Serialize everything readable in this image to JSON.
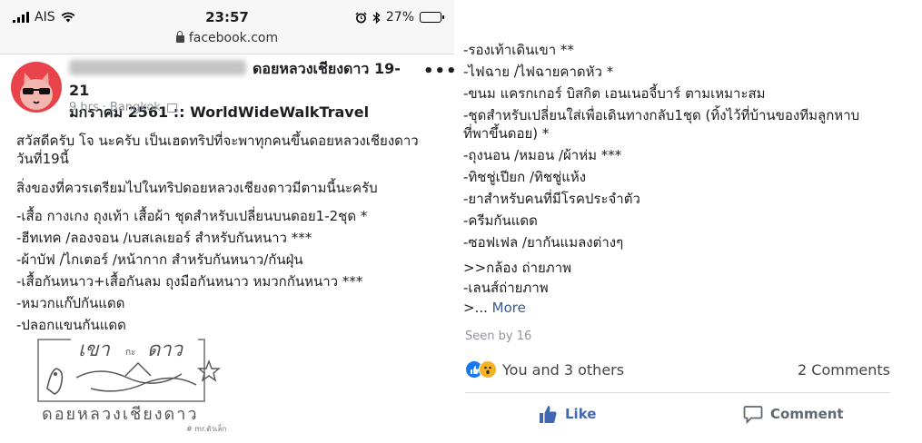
{
  "status_bar": {
    "carrier": "AIS",
    "time": "23:57",
    "battery": "27%",
    "battery_level": 0.27
  },
  "browser": {
    "url": "facebook.com"
  },
  "post": {
    "title_line1": "ดอยหลวงเชียงดาว 19-21",
    "title_line2": "มกราคม 2561 :: WorldWideWalkTravel",
    "time": "9 hrs",
    "location": "Bangkok",
    "paragraphs": [
      "สวัสดีครับ โจ นะครับ เป็นเฮดทริปที่จะพาทุกคนขึ้นดอยหลวงเชียงดาว",
      "วันที่19นี้",
      "สิ่งของที่ควรเตรียมไปในทริปดอยหลวงเชียงดาวมีตามนี้นะครับ"
    ],
    "items_left": [
      "-เสื้อ กางเกง ถุงเท้า เสื้อผ้า ชุดสำหรับเปลี่ยนบนดอย1-2ชุด *",
      "-ฮีทเทค /ลองจอน /เบสเลเยอร์ สำหรับกันหนาว ***",
      "-ผ้าบัฟ /ไกเตอร์ /หน้ากาก สำหรับกันหนาว/กันฝุ่น",
      "-เสื้อกันหนาว+เสื้อกันลม ถุงมือกันหนาว หมวกกันหนาว ***",
      "-หมวกแก๊ปกันแดด",
      "-ปลอกแขนกันแดด"
    ],
    "items_right": [
      "-รองเท้าเดินเขา **",
      "-ไฟฉาย /ไฟฉายคาดหัว *",
      "-ขนม แครกเกอร์ บิสกิต เอนเนอจี้บาร์ ตามเหมาะสม",
      "-ชุดสำหรับเปลี่ยนใส่เพื่อเดินทางกลับ1ชุด (ทิ้งไว้ที่บ้านของทีมลูกหาบ",
      "ที่พาขึ้นดอย) *",
      "-ถุงนอน /หมอน /ผ้าห่ม ***",
      "-ทิชชู่เปียก /ทิชชู่แห้ง",
      "-ยาสำหรับคนที่มีโรคประจำตัว",
      "-ครีมกันแดด",
      "-ซอฟเฟล /ยากันแมลงต่างๆ",
      ">>กล้อง ถ่ายภาพ",
      "-เลนส์ถ่ายภาพ"
    ],
    "more_prefix": ">...",
    "more_label": "More"
  },
  "logo": {
    "line1_a": "เขา",
    "line1_b": "กะ",
    "line1_c": "ดาว",
    "line2": "ดอยหลวงเชียงดาว",
    "credit": "# mr.ตัวเล็ก"
  },
  "footer": {
    "seen_by": "Seen by 16",
    "reactors": "You and 3 others",
    "comments": "2 Comments",
    "like_label": "Like",
    "comment_label": "Comment"
  },
  "colors": {
    "link_blue": "#385898",
    "like_blue": "#4267b2",
    "avatar_red": "#e8424b",
    "meta_gray": "#90949c"
  }
}
